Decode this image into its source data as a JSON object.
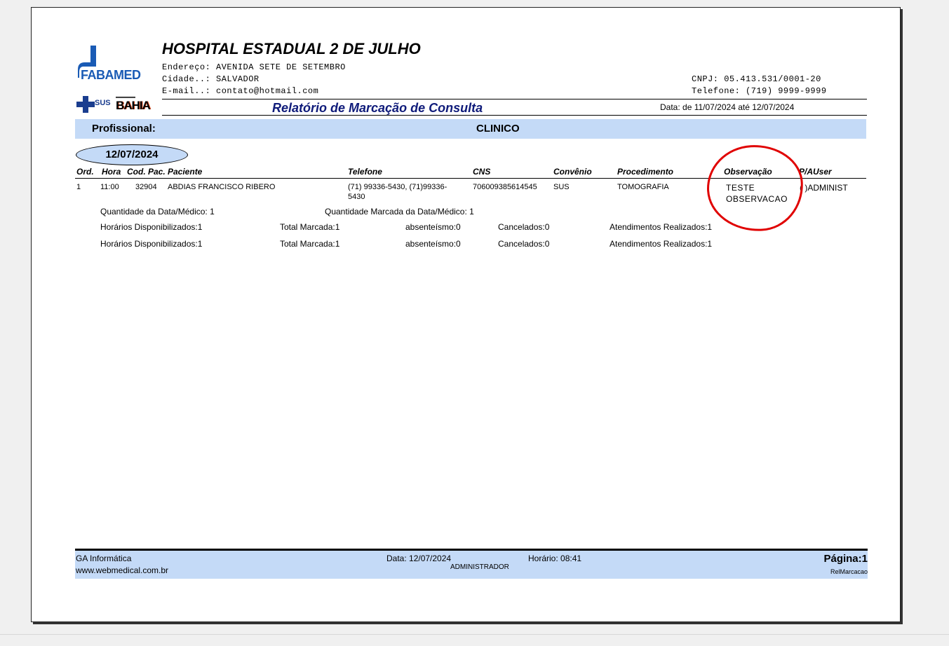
{
  "header": {
    "hospital_name": "HOSPITAL ESTADUAL 2 DE JULHO",
    "address": "Endereço: AVENIDA SETE DE SETEMBRO",
    "city": "Cidade..: SALVADOR",
    "email": "E-mail..: contato@hotmail.com",
    "cnpj": "CNPJ: 05.413.531/0001-20",
    "phone": "Telefone: (719) 9999-9999",
    "report_title": "Relatório de Marcação de Consulta",
    "period": "Data: de 11/07/2024   até  12/07/2024",
    "logo_text": "FABAMED",
    "sus_text": "SUS",
    "bahia_text": "BAHIA"
  },
  "professional": {
    "label": "Profissional:",
    "value": "CLINICO"
  },
  "date_group": "12/07/2024",
  "table": {
    "headers": [
      "Ord.",
      "Hora",
      "Cod. Pac.",
      "Paciente",
      "Telefone",
      "CNS",
      "Convênio",
      "Procedimento",
      "Observação",
      "P/AUser"
    ],
    "row": {
      "ord": "1",
      "hora": "11:00",
      "cod": "32904",
      "paciente": "ABDIAS FRANCISCO RIBERO",
      "telefone_l1": "(71) 99336-5430, (71)99336-",
      "telefone_l2": "5430",
      "cns": "706009385614545",
      "convenio": "SUS",
      "procedimento": "TOMOGRAFIA",
      "obs_l1": "TESTE",
      "obs_l2": "OBSERVACAO",
      "pau": "(   )ADMINIST"
    }
  },
  "summary": {
    "qtd_data": "Quantidade da Data/Médico: 1",
    "qtd_marcada": "Quantidade Marcada da Data/Médico: 1",
    "lines": [
      {
        "horarios": "Horários Disponibilizados:1",
        "total": "Total Marcada:1",
        "abs": "absenteísmo:0",
        "canc": "Cancelados:0",
        "atend": "Atendimentos Realizados:1"
      },
      {
        "horarios": "Horários Disponibilizados:1",
        "total": "Total Marcada:1",
        "abs": "absenteísmo:0",
        "canc": "Cancelados:0",
        "atend": "Atendimentos Realizados:1"
      }
    ]
  },
  "footer": {
    "company": "GA Informática",
    "site": "www.webmedical.com.br",
    "date": "Data: 12/07/2024",
    "user": "ADMINISTRADOR",
    "time": "Horário: 08:41",
    "page": "Página:1",
    "report_id": "RelMarcacao"
  },
  "colors": {
    "band": "#c4daf7",
    "annotation": "#e00000",
    "title_blue": "#0f1b7a"
  }
}
